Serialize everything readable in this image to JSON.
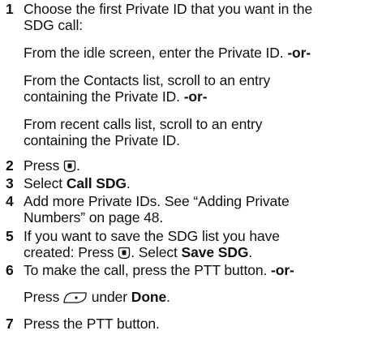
{
  "steps": [
    {
      "number": "1",
      "lines": [
        "Choose the first Private ID that you want in the",
        "SDG call:"
      ],
      "sub": [
        {
          "lines": [
            "From the idle screen, enter the Private ID."
          ],
          "or": "-or-"
        },
        {
          "lines": [
            "From the Contacts list, scroll to an entry",
            "containing the Private ID."
          ],
          "or": "-or-"
        },
        {
          "lines": [
            "From recent calls list, scroll to an entry",
            "containing the Private ID."
          ]
        }
      ]
    },
    {
      "number": "2",
      "prefix": "Press",
      "icon": "menu-key-icon",
      "suffix": "."
    },
    {
      "number": "3",
      "prefix": "Select ",
      "bold": "Call SDG",
      "suffix": "."
    },
    {
      "number": "4",
      "lines": [
        "Add more Private IDs. See “Adding Private",
        "Numbers” on page 48."
      ]
    },
    {
      "number": "5",
      "line1": "If you want to save the SDG list you have",
      "line2_prefix": "created: Press",
      "icon": "menu-key-icon",
      "line2_mid": ". Select ",
      "bold": "Save SDG",
      "suffix": "."
    },
    {
      "number": "6",
      "line1": "To make the call, press the PTT button.",
      "or": "-or-",
      "sub_prefix": "Press",
      "icon": "softkey-icon",
      "sub_mid": "under ",
      "bold": "Done",
      "suffix": "."
    },
    {
      "number": "7",
      "text": "Press the PTT button."
    }
  ]
}
